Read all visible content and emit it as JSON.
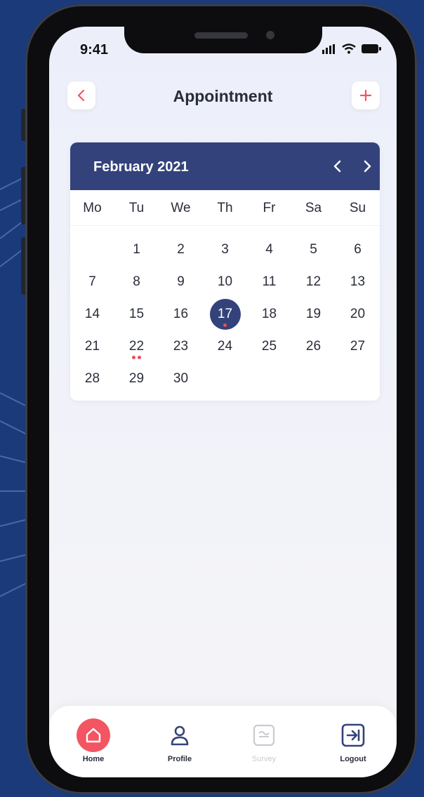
{
  "status": {
    "time": "9:41"
  },
  "header": {
    "title": "Appointment"
  },
  "calendar": {
    "month_label": "February 2021",
    "weekdays": [
      "Mo",
      "Tu",
      "We",
      "Th",
      "Fr",
      "Sa",
      "Su"
    ],
    "weeks": [
      [
        "",
        "1",
        "2",
        "3",
        "4",
        "5",
        "6"
      ],
      [
        "7",
        "8",
        "9",
        "10",
        "11",
        "12",
        "13"
      ],
      [
        "14",
        "15",
        "16",
        "17",
        "18",
        "19",
        "20"
      ],
      [
        "21",
        "22",
        "23",
        "24",
        "25",
        "26",
        "27"
      ],
      [
        "28",
        "29",
        "30",
        "",
        "",
        "",
        ""
      ]
    ],
    "selected_day": "17",
    "event_markers": {
      "17": 1,
      "22": 2
    }
  },
  "bottom_nav": {
    "items": [
      {
        "label": "Home",
        "icon": "home-icon"
      },
      {
        "label": "Profile",
        "icon": "user-icon"
      },
      {
        "label": "Survey",
        "icon": "survey-icon"
      },
      {
        "label": "Logout",
        "icon": "logout-icon"
      }
    ]
  },
  "colors": {
    "accent": "#33427b",
    "danger": "#f35562",
    "event_dot": "#ef4c57",
    "background": "#1b3a7a"
  }
}
